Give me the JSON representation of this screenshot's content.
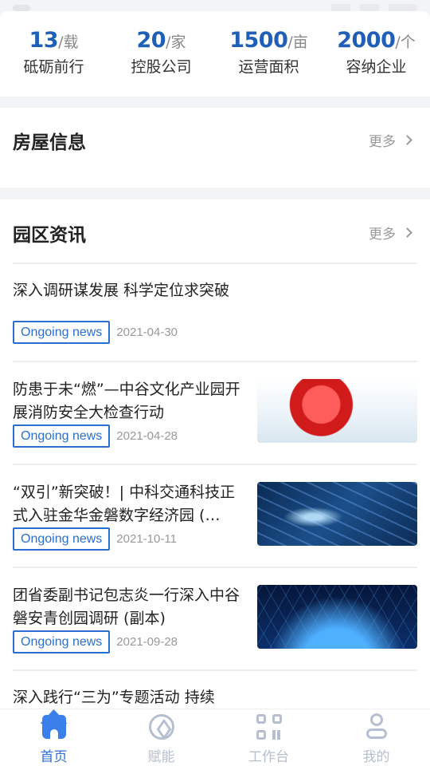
{
  "stats": [
    {
      "value": "13",
      "unit": "/载",
      "label": "砥砺前行"
    },
    {
      "value": "20",
      "unit": "/家",
      "label": "控股公司"
    },
    {
      "value": "1500",
      "unit": "/亩",
      "label": "运营面积"
    },
    {
      "value": "2000",
      "unit": "/个",
      "label": "容纳企业"
    }
  ],
  "housing": {
    "title": "房屋信息",
    "more": "更多"
  },
  "news": {
    "title": "园区资讯",
    "more": "更多",
    "items": [
      {
        "title": "深入调研谋发展 科学定位求突破",
        "tag": "Ongoing news",
        "date": "2021-04-30"
      },
      {
        "title": "防患于未“燃”—中谷文化产业园开展消防安全大检查行动",
        "tag": "Ongoing news",
        "date": "2021-04-28"
      },
      {
        "title": "“双引”新突破！| 中科交通科技正式入驻金华金磐数字经济园 (…",
        "tag": "Ongoing news",
        "date": "2021-10-11"
      },
      {
        "title": "团省委副书记包志炎一行深入中谷磐安青创园调研 (副本)",
        "tag": "Ongoing news",
        "date": "2021-09-28"
      },
      {
        "title": "深入践行“三为”专题活动 持续"
      }
    ]
  },
  "tabbar": [
    {
      "label": "首页",
      "icon": "home-icon",
      "active": true
    },
    {
      "label": "赋能",
      "icon": "compass-icon"
    },
    {
      "label": "工作台",
      "icon": "grid-icon"
    },
    {
      "label": "我的",
      "icon": "user-icon"
    }
  ],
  "colors": {
    "accent": "#2c6fd8",
    "statValue": "#1f5fb8",
    "tagBorder": "#2a6fd0",
    "inactive": "#b6bfcf"
  }
}
